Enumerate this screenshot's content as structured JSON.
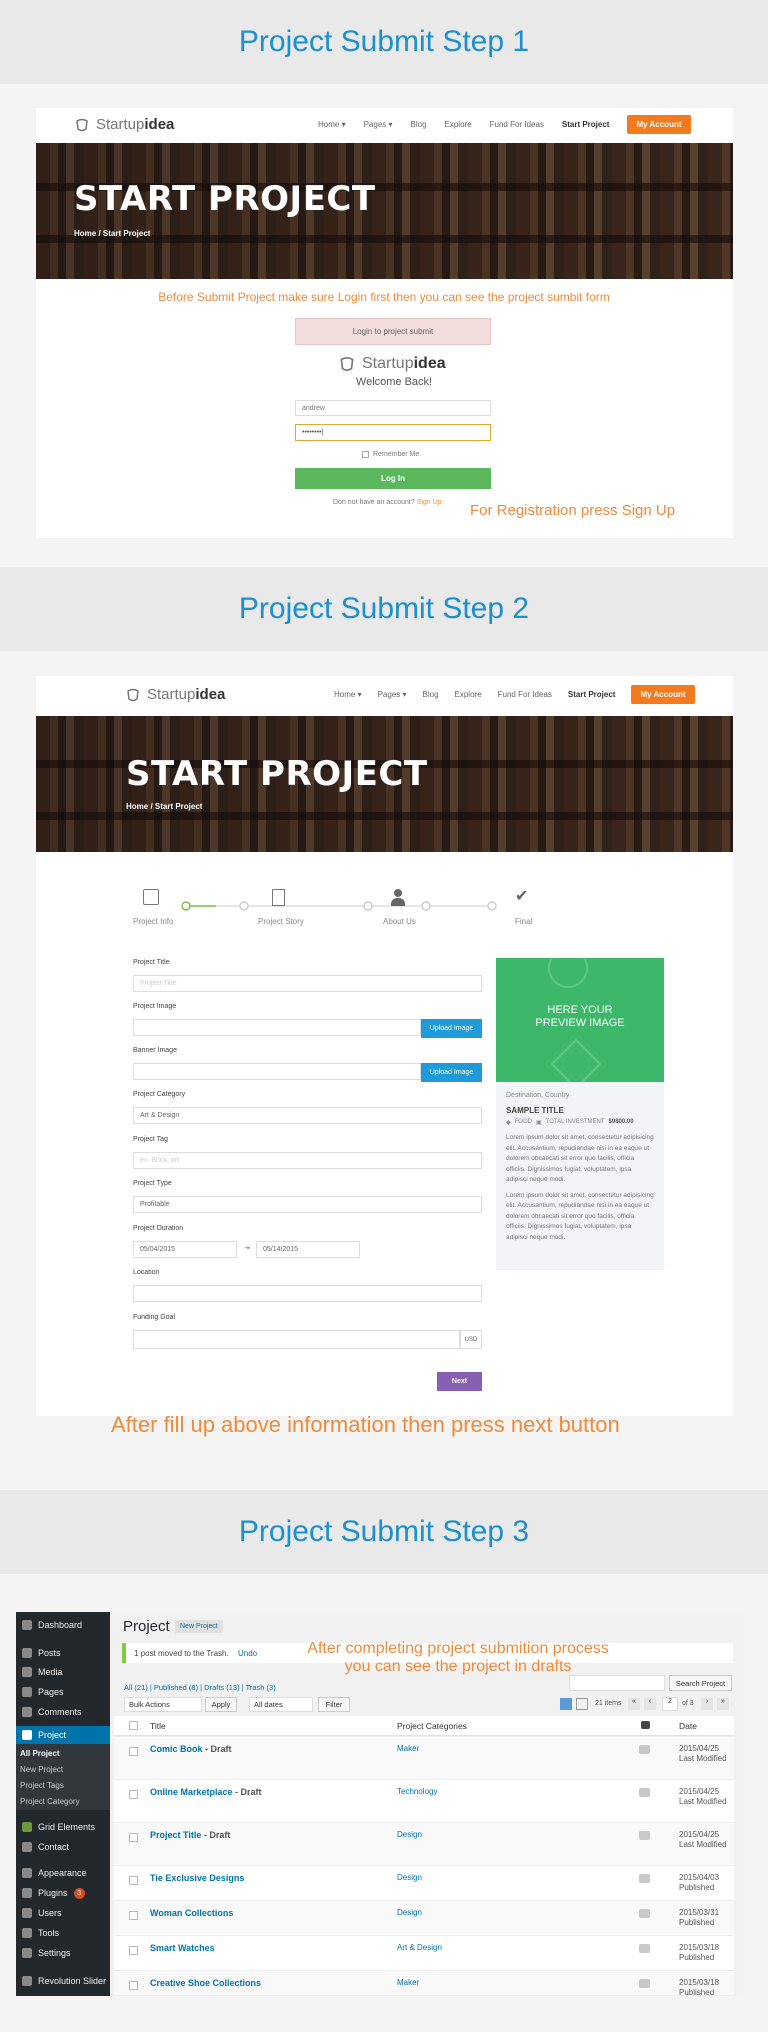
{
  "step1": {
    "heading": "Project Submit Step 1",
    "logo": {
      "light": "Startup",
      "bold": "idea"
    },
    "nav": [
      "Home ▾",
      "Pages ▾",
      "Blog",
      "Explore",
      "Fund For Ideas",
      "Start Project"
    ],
    "my_account": "My Account",
    "hero_title": "START PROJECT",
    "breadcrumb": "Home  /  Start Project",
    "notice": "Before Submit Project make sure Login first then you can see the project sumbit form",
    "login_banner": "Login to project submit",
    "welcome": "Welcome Back!",
    "username_value": "andrew",
    "password_value": "••••••••|",
    "remember": "Remember Me",
    "login_button": "Log In",
    "no_account": "Don not have an account?",
    "signup": "Sign Up",
    "note": "For Registration press Sign Up"
  },
  "step2": {
    "heading": "Project Submit Step 2",
    "hero_title": "START PROJECT",
    "breadcrumb": "Home  /  Start Project",
    "steps": [
      "Project Info",
      "Project Story",
      "About Us",
      "Final"
    ],
    "fields": {
      "title_label": "Project Title",
      "title_placeholder": "Project Title",
      "image_label": "Project Image",
      "banner_label": "Banner Image",
      "upload": "Upload Image",
      "category_label": "Project Category",
      "category_value": "Art & Design",
      "tag_label": "Project Tag",
      "tag_placeholder": "ex. Brick, art",
      "type_label": "Project Type",
      "type_value": "Profitable",
      "duration_label": "Project Duration",
      "date_from": "05/04/2015",
      "date_sep": "⇥",
      "date_to": "05/14/2015",
      "location_label": "Location",
      "goal_label": "Funding Goal",
      "currency": "USD"
    },
    "next": "Next",
    "preview": {
      "image_text_1": "HERE YOUR",
      "image_text_2": "PREVIEW IMAGE",
      "destination": "Destination, Country",
      "title": "SAMPLE TITLE",
      "meta_1": "FOOD",
      "meta_2": "TOTAL INVESTMENT",
      "meta_amount": "$9800.00",
      "para1": "Lorem ipsum dolor sit amet, consectetur adipisicing elit. Accusantium, repudiandae nisi in ea eaque ut dolorem obcaecati sit error quo facilis, officia officiis. Dignissimos fugiat, voluptatem, ipsa adipisci neque modi.",
      "para2": "Lorem ipsum dolor sit amet, consectetur adipisicing elit. Accusantium, repudiandae nisi in ea eaque ut dolorem obcaecati sit error quo facilis, officia officiis. Dignissimos fugiat, voluptatem, ipsa adipisci neque modi."
    },
    "note": "After fill up above information then press next button"
  },
  "step3": {
    "heading": "Project Submit Step 3",
    "sidebar": [
      "Dashboard",
      "Posts",
      "Media",
      "Pages",
      "Comments",
      "Project",
      "Grid Elements",
      "Contact",
      "Appearance",
      "Plugins",
      "Users",
      "Tools",
      "Settings",
      "Revolution Slider"
    ],
    "sub": [
      "All Project",
      "New Project",
      "Project Tags",
      "Project Category"
    ],
    "plugins_badge": "3",
    "page_title": "Project",
    "new_project": "New Project",
    "trash_msg": "1 post moved to the Trash.",
    "undo": "Undo",
    "note_1": "After completing project submition process",
    "note_2": "you can see the project in drafts",
    "filters": "All (21) | Published (8) | Drafts (13) | Trash (3)",
    "search_button": "Search Project",
    "bulk": "Bulk Actions",
    "apply": "Apply",
    "dates": "All dates",
    "filter": "Filter",
    "items": "21 items",
    "page": "2",
    "of": "of 3",
    "cols": [
      "Title",
      "Project Categories",
      "Date"
    ],
    "rows": [
      {
        "title": "Comic Book",
        "state": " - Draft",
        "cat": "Maker",
        "date": "2015/04/25 Last Modified"
      },
      {
        "title": "Online Marketplace",
        "state": " - Draft",
        "cat": "Technology",
        "date": "2015/04/25 Last Modified"
      },
      {
        "title": "Project Title",
        "state": " - Draft",
        "cat": "Design",
        "date": "2015/04/25 Last Modified"
      },
      {
        "title": "Tie Exclusive Designs",
        "state": "",
        "cat": "Design",
        "date": "2015/04/03 Published"
      },
      {
        "title": "Woman Collections",
        "state": "",
        "cat": "Design",
        "date": "2015/03/31 Published"
      },
      {
        "title": "Smart Watches",
        "state": "",
        "cat": "Art & Design",
        "date": "2015/03/18 Published"
      },
      {
        "title": "Creative Shoe Collections",
        "state": "",
        "cat": "Maker",
        "date": "2015/03/18 Published"
      }
    ]
  }
}
